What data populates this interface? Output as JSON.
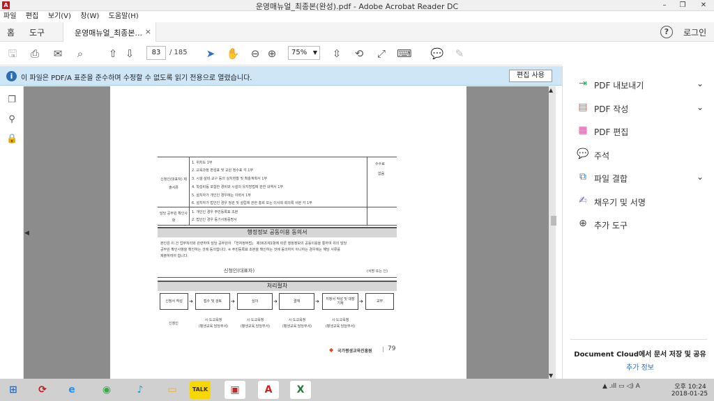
{
  "window": {
    "title": "운영매뉴얼_최종본(완성).pdf - Adobe Acrobat Reader DC",
    "minimize": "–",
    "maximize": "❐",
    "close": "✕"
  },
  "menu": [
    "파일",
    "편집",
    "보기(V)",
    "창(W)",
    "도움말(H)"
  ],
  "tabs": {
    "home": "홈",
    "tools": "도구",
    "document": "운영매뉴얼_최종본...",
    "close": "×"
  },
  "header": {
    "help": "?",
    "login": "로그인"
  },
  "toolbar": {
    "page_current": "83",
    "page_total": "/ 185",
    "zoom": "75%"
  },
  "infobar": {
    "message": "이 파일은 PDF/A 표준을 준수하며 수정할 수 없도록 읽기 전용으로 열렸습니다.",
    "enable_edit": "편집 사용"
  },
  "right_panel": {
    "items": [
      {
        "label": "PDF 내보내기",
        "icon": "export-pdf-icon",
        "color": "#2e9e6a",
        "expand": true
      },
      {
        "label": "PDF 작성",
        "icon": "create-pdf-icon",
        "color": "#e05a4f",
        "expand": true
      },
      {
        "label": "PDF 편집",
        "icon": "edit-pdf-icon",
        "color": "#d8509b",
        "expand": false
      },
      {
        "label": "주석",
        "icon": "comment-icon",
        "color": "#e9b52c",
        "expand": false
      },
      {
        "label": "파일 결합",
        "icon": "combine-files-icon",
        "color": "#2f7fc1",
        "expand": true
      },
      {
        "label": "채우기 및 서명",
        "icon": "fill-sign-icon",
        "color": "#7a5cc4",
        "expand": false
      },
      {
        "label": "추가 도구",
        "icon": "more-tools-icon",
        "color": "#444444",
        "expand": false
      }
    ],
    "cloud_text": "Document Cloud에서 문서 저장 및 공유",
    "cloud_link": "추가 정보"
  },
  "document": {
    "applicant_label": "신청인(대표자) 제출서류",
    "items": [
      "1. 위치도 1부",
      "2. 교육과정 편성표 및 교원 정수표 각 1부",
      "3. 시설·설비·교구 등의 실치현황 및 확충계획서 1부",
      "4. 학습비등 포함한 경비와 시설의 유지방법에 관한 내역서 1부",
      "5. 설치자가 개인인 경우에는 이력서 1부",
      "6. 설치자가 법인인 경우 정관 및 설립에 관한 총회 또는 이사회 회의록 사본 각 1부"
    ],
    "fee_label": "수수료",
    "fee_value": "없음",
    "official_label": "담당 공무원 확인사항",
    "official_items": [
      "1. 개인인 경우 주민등록표 초본",
      "2. 법인인 경우 등기사항증명서"
    ],
    "consent_title": "행정정보 공동이용 동의서",
    "consent_text": [
      "본인은 이 건 업무처리와 관련하여 담당 공무원이 「전자정부법」 제36조제1항에 따른 행정정보의 공동이용을 통하여 위의 담당",
      "공무원 확인사항을 확인하는 것에 동의합니다. ※ 주민등록표 초본을 확인하는 것에 동의하지 아니하는 경우에는 해당 서류를",
      "제출하여야 합니다."
    ],
    "signer": "신청인(대표자)",
    "sign_note": "(서명 또는 인)",
    "process_title": "처리절차",
    "steps": [
      "신청서 작성",
      "접수 및 검토",
      "심의",
      "결재",
      "지정서 작성 및 대장 기재",
      "교부"
    ],
    "actor_label": "신청인",
    "step_actors": [
      [
        "시·도교육청",
        "(평생교육 담당부서)"
      ],
      [
        "시·도교육청",
        "(평생교육 담당부서)"
      ],
      [
        "시·도교육청",
        "(평생교육 담당부서)"
      ],
      [
        "시·도교육청",
        "(평생교육 담당부서)"
      ]
    ],
    "footer_org": "국가평생교육진흥원",
    "footer_sep": "|",
    "page_number": "79"
  },
  "taskbar": {
    "apps": [
      {
        "name": "start",
        "glyph": "⊞",
        "color": "#1f6fd1"
      },
      {
        "name": "recovery",
        "glyph": "⟳",
        "color": "#c0161c"
      },
      {
        "name": "internet-explorer",
        "glyph": "e",
        "color": "#1e90ff"
      },
      {
        "name": "chrome",
        "glyph": "◉",
        "color": "#3aa845"
      },
      {
        "name": "music-player",
        "glyph": "♪",
        "color": "#16a0c8"
      },
      {
        "name": "file-explorer",
        "glyph": "▭",
        "color": "#e3b23c"
      },
      {
        "name": "kakaotalk",
        "glyph": "TALK",
        "color": "#3b2a1a"
      },
      {
        "name": "app-red",
        "glyph": "▣",
        "color": "#c62828"
      },
      {
        "name": "acrobat",
        "glyph": "A",
        "color": "#d11f1f"
      },
      {
        "name": "excel",
        "glyph": "X",
        "color": "#1f7a3a"
      }
    ],
    "tray": "▲ .ıll ▭ ◁) A",
    "time": "오후 10:24",
    "date": "2018-01-25"
  }
}
